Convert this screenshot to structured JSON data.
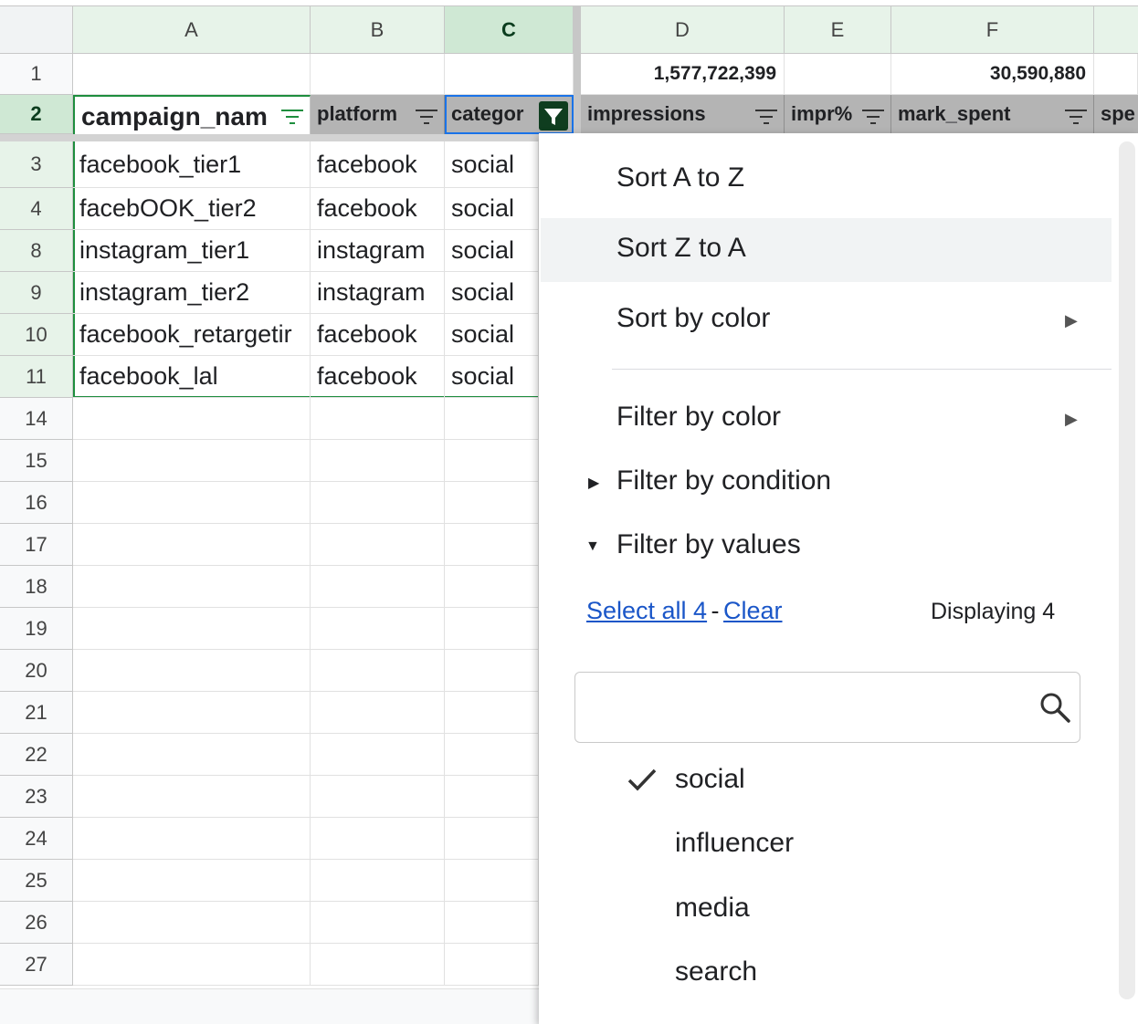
{
  "columns": [
    "A",
    "B",
    "C",
    "D",
    "E",
    "F"
  ],
  "row_numbers": [
    "1",
    "2",
    "3",
    "4",
    "8",
    "9",
    "10",
    "11",
    "14",
    "15",
    "16",
    "17",
    "18",
    "19",
    "20",
    "21",
    "22",
    "23",
    "24",
    "25",
    "26",
    "27"
  ],
  "row1": {
    "D": "1,577,722,399",
    "F": "30,590,880"
  },
  "headers": {
    "A": "campaign_nam",
    "B": "platform",
    "C": "categor",
    "D": "impressions",
    "E": "impr%",
    "F": "mark_spent",
    "G": "spe"
  },
  "rows": [
    {
      "A": "facebook_tier1",
      "B": "facebook",
      "C": "social"
    },
    {
      "A": "facebOOK_tier2",
      "B": "facebook",
      "C": "social"
    },
    {
      "A": "instagram_tier1",
      "B": "instagram",
      "C": "social"
    },
    {
      "A": "instagram_tier2",
      "B": "instagram",
      "C": "social"
    },
    {
      "A": "facebook_retargetir",
      "B": "facebook",
      "C": "social"
    },
    {
      "A": "facebook_lal",
      "B": "facebook",
      "C": "social"
    }
  ],
  "menu": {
    "sort_az": "Sort A to Z",
    "sort_za": "Sort Z to A",
    "sort_color": "Sort by color",
    "filter_color": "Filter by color",
    "filter_condition": "Filter by condition",
    "filter_values": "Filter by values",
    "select_all": "Select all 4",
    "dash": "-",
    "clear": "Clear",
    "displaying": "Displaying 4",
    "search_placeholder": "",
    "values": [
      {
        "label": "social",
        "checked": true
      },
      {
        "label": "influencer",
        "checked": false
      },
      {
        "label": "media",
        "checked": false
      },
      {
        "label": "search",
        "checked": false
      }
    ]
  },
  "icons": {
    "filter": "filter-lines-icon",
    "active_filter": "funnel-icon",
    "submenu": "triangle-right-icon",
    "expand": "triangle-down-icon",
    "search": "magnifier-icon",
    "check": "checkmark-icon"
  },
  "colors": {
    "header_green": "#e7f3e9",
    "selected_green": "#cfe8d4",
    "link": "#1a56c8",
    "filter_header": "#b4b4b4"
  }
}
